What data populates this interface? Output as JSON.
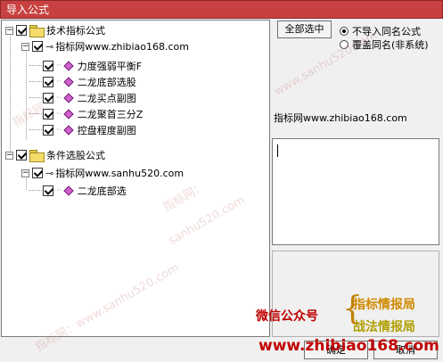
{
  "window": {
    "title": "导入公式"
  },
  "tree": {
    "groups": [
      {
        "label": "技术指标公式",
        "source": "指标网www.zhibiao168.com",
        "items": [
          "力度强弱平衡F",
          "二龙底部选股",
          "二龙买点副图",
          "二龙聚首三分Z",
          "控盘程度副图"
        ]
      },
      {
        "label": "条件选股公式",
        "source": "指标网www.sanhu520.com",
        "items": [
          "二龙底部选"
        ]
      }
    ]
  },
  "controls": {
    "select_all": "全部选中",
    "radio_options": [
      "不导入同名公式",
      "覆盖同名(非系统)"
    ],
    "radio_selected": 0,
    "ok": "确定",
    "cancel": "取消"
  },
  "info": {
    "source_text": "指标网www.zhibiao168.com"
  },
  "watermarks": [
    "www.sanhu520.com",
    "指标网",
    "指标网：",
    "sanhu520.com",
    "指标网：www.sanhu520.com"
  ],
  "promo": {
    "wechat": "微信公众号",
    "line1": "指标情报局",
    "line2": "战法情报局",
    "url": "www.zhibiao168.com"
  }
}
